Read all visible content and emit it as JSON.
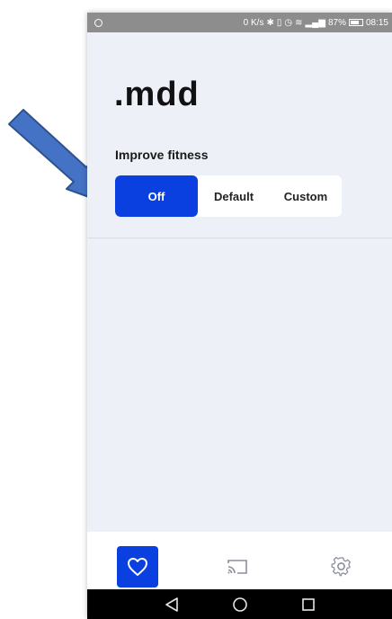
{
  "status_bar": {
    "speed": "0 K/s",
    "battery": "87%",
    "time": "08:15"
  },
  "app": {
    "logo": ".mdd"
  },
  "fitness": {
    "label": "Improve fitness",
    "options": [
      "Off",
      "Default",
      "Custom"
    ],
    "selected": "Off"
  },
  "colors": {
    "accent": "#0a3fe0",
    "background": "#eef0f8",
    "annotation_arrow": "#4472c4"
  },
  "bottom_nav": {
    "items": [
      "heart-icon",
      "cast-icon",
      "settings-icon"
    ],
    "active": "heart-icon"
  },
  "system_nav": {
    "buttons": [
      "back-icon",
      "home-icon",
      "recents-icon"
    ]
  }
}
